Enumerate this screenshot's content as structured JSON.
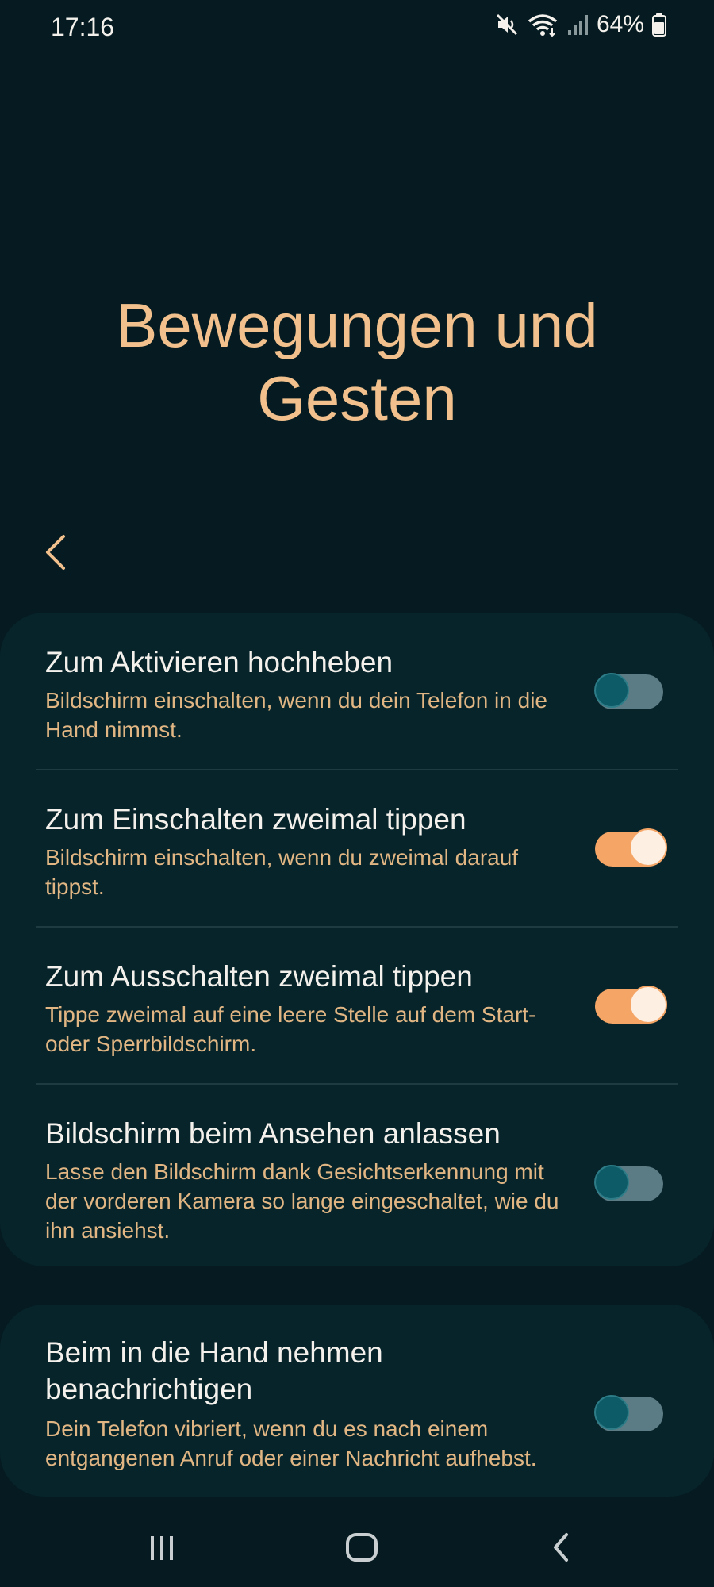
{
  "status": {
    "time": "17:16",
    "battery": "64%",
    "icons": [
      "mute-icon",
      "wifi-icon",
      "signal-icon",
      "battery-icon"
    ]
  },
  "page": {
    "title": "Bewegungen und Gesten"
  },
  "colors": {
    "background": "#051b21",
    "card": "#07242b",
    "title_accent": "#f1c08c",
    "description": "#e1b683",
    "toggle_on": "#f5a565",
    "toggle_off_track": "#5b7c84",
    "toggle_off_knob": "#0d5b66"
  },
  "settings": [
    {
      "title": "Zum Aktivieren hochheben",
      "description": "Bildschirm einschalten, wenn du dein Telefon in die Hand nimmst.",
      "enabled": false
    },
    {
      "title": "Zum Einschalten zweimal tippen",
      "description": "Bildschirm einschalten, wenn du zweimal darauf tippst.",
      "enabled": true
    },
    {
      "title": "Zum Ausschalten zweimal tippen",
      "description": "Tippe zweimal auf eine leere Stelle auf dem Start- oder Sperrbildschirm.",
      "enabled": true
    },
    {
      "title": "Bildschirm beim Ansehen anlassen",
      "description": "Lasse den Bildschirm dank Gesichtserkennung mit der vorderen Kamera so lange eingeschaltet, wie du ihn ansiehst.",
      "enabled": false
    }
  ],
  "settings_group2": [
    {
      "title": "Beim in die Hand nehmen benachrichtigen",
      "description": "Dein Telefon vibriert, wenn du es nach einem entgangenen Anruf oder einer Nachricht aufhebst.",
      "enabled": false
    }
  ],
  "nav": {
    "icons": [
      "recent-apps-icon",
      "home-icon",
      "back-icon"
    ]
  }
}
